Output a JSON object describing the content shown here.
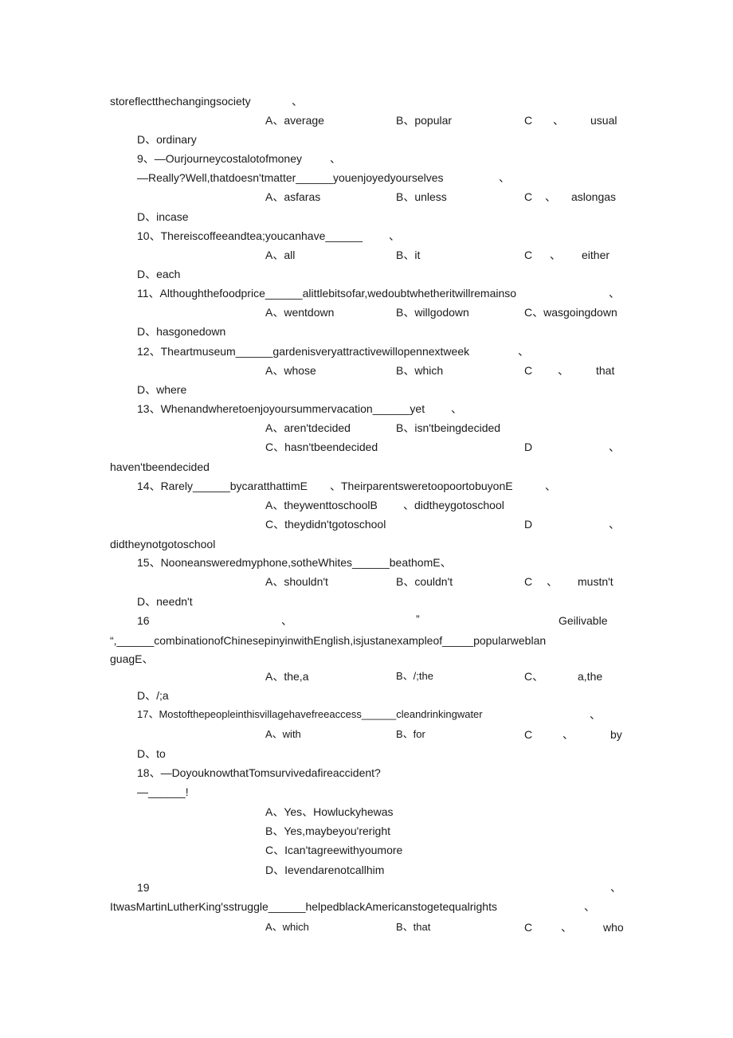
{
  "document": {
    "q8": {
      "stem_tail": "storeflectthechangingsociety",
      "stem_mark": "、",
      "options": {
        "A": "A、average",
        "B": "B、popular",
        "C_letter": "C",
        "C_sep": "、",
        "C_text": "usual",
        "D": "D、ordinary"
      }
    },
    "q9": {
      "line1": "9、—Ourjourneycostalotofmoney",
      "line1_mark": "、",
      "line2": "—Really?Well,thatdoesn'tmatter______youenjoyedyourselves",
      "line2_mark": "、",
      "options": {
        "A": "A、asfaras",
        "B": "B、unless",
        "C_letter": "C",
        "C_sep": "、",
        "C_text": "aslongas",
        "D": "D、incase"
      }
    },
    "q10": {
      "stem": "10、Thereiscoffeeandtea;youcanhave______",
      "stem_mark": "、",
      "options": {
        "A": "A、all",
        "B": "B、it",
        "C_letter": "C",
        "C_sep": "、",
        "C_text": "either",
        "D": "D、each"
      }
    },
    "q11": {
      "stem": "11、Althoughthefoodprice______alittlebitsofar,wedoubtwhetheritwillremainso",
      "stem_mark": "、",
      "options": {
        "A": "A、wentdown",
        "B": "B、willgodown",
        "C": "C、wasgoingdown",
        "D": "D、hasgonedown"
      }
    },
    "q12": {
      "stem": "12、Theartmuseum______gardenisveryattractivewillopennextweek",
      "stem_mark": "、",
      "options": {
        "A": "A、whose",
        "B": "B、which",
        "C_letter": "C",
        "C_sep": "、",
        "C_text": "that",
        "D": "D、where"
      }
    },
    "q13": {
      "stem": "13、Whenandwheretoenjoyoursummervacation______yet",
      "stem_mark": "、",
      "options": {
        "A": "A、aren'tdecided",
        "B": "B、isn'tbeingdecided",
        "C": "C、hasn'tbeendecided",
        "D_letter": "D",
        "D_sep": "、",
        "D_text": "haven'tbeendecided"
      }
    },
    "q14": {
      "stem": "14、Rarely______bycaratthattimE",
      "stem_mid": "、TheirparentsweretoopoortobuyonE",
      "stem_mark": "、",
      "options": {
        "A": "A、theywenttoschoolB",
        "B": "、didtheygotoschool",
        "C": "C、theydidn'tgotoschool",
        "D_letter": "D",
        "D_sep": "、",
        "D_text": "didtheynotgotoschool"
      }
    },
    "q15": {
      "stem": "15、Nooneansweredmyphone,sotheWhites______beathomE、",
      "options": {
        "A": "A、shouldn't",
        "B": "B、couldn't",
        "C_letter": "C",
        "C_sep": "、",
        "C_text": "mustn't",
        "D": "D、needn't"
      }
    },
    "q16": {
      "number": "16",
      "sep": "、",
      "quote_close": "”",
      "word": "Geilivable",
      "line2": "“,______combinationofChinesepinyinwithEnglish,isjustanexampleof_____popularweblan",
      "line3": "guagE、",
      "options": {
        "A": "A、the,a",
        "B": "B、/;the",
        "C_letter": "C、",
        "C_text": "a,the",
        "D": "D、/;a"
      }
    },
    "q17": {
      "stem": "17、Mostofthepeopleinthisvillagehavefreeaccess______cleandrinkingwater",
      "stem_mark": "、",
      "options": {
        "A": "A、with",
        "B": "B、for",
        "C_letter": "C",
        "C_sep": "、",
        "C_text": "by",
        "D": "D、to"
      }
    },
    "q18": {
      "line1": "18、—DoyouknowthatTomsurvivedafireaccident?",
      "line2": "—______!",
      "options": {
        "A": "A、Yes、Howluckyhewas",
        "B": "B、Yes,maybeyou'reright",
        "C": "C、Ican'tagreewithyoumore",
        "D": "D、Ievendarenotcallhim"
      }
    },
    "q19": {
      "number": "19",
      "number_mark": "、",
      "stem": "ItwasMartinLutherKing'sstruggle______helpedblackAmericanstogetequalrights",
      "stem_mark": "、",
      "options": {
        "A": "A、which",
        "B": "B、that",
        "C_letter": "C",
        "C_sep": "、",
        "C_text": "who"
      }
    }
  }
}
